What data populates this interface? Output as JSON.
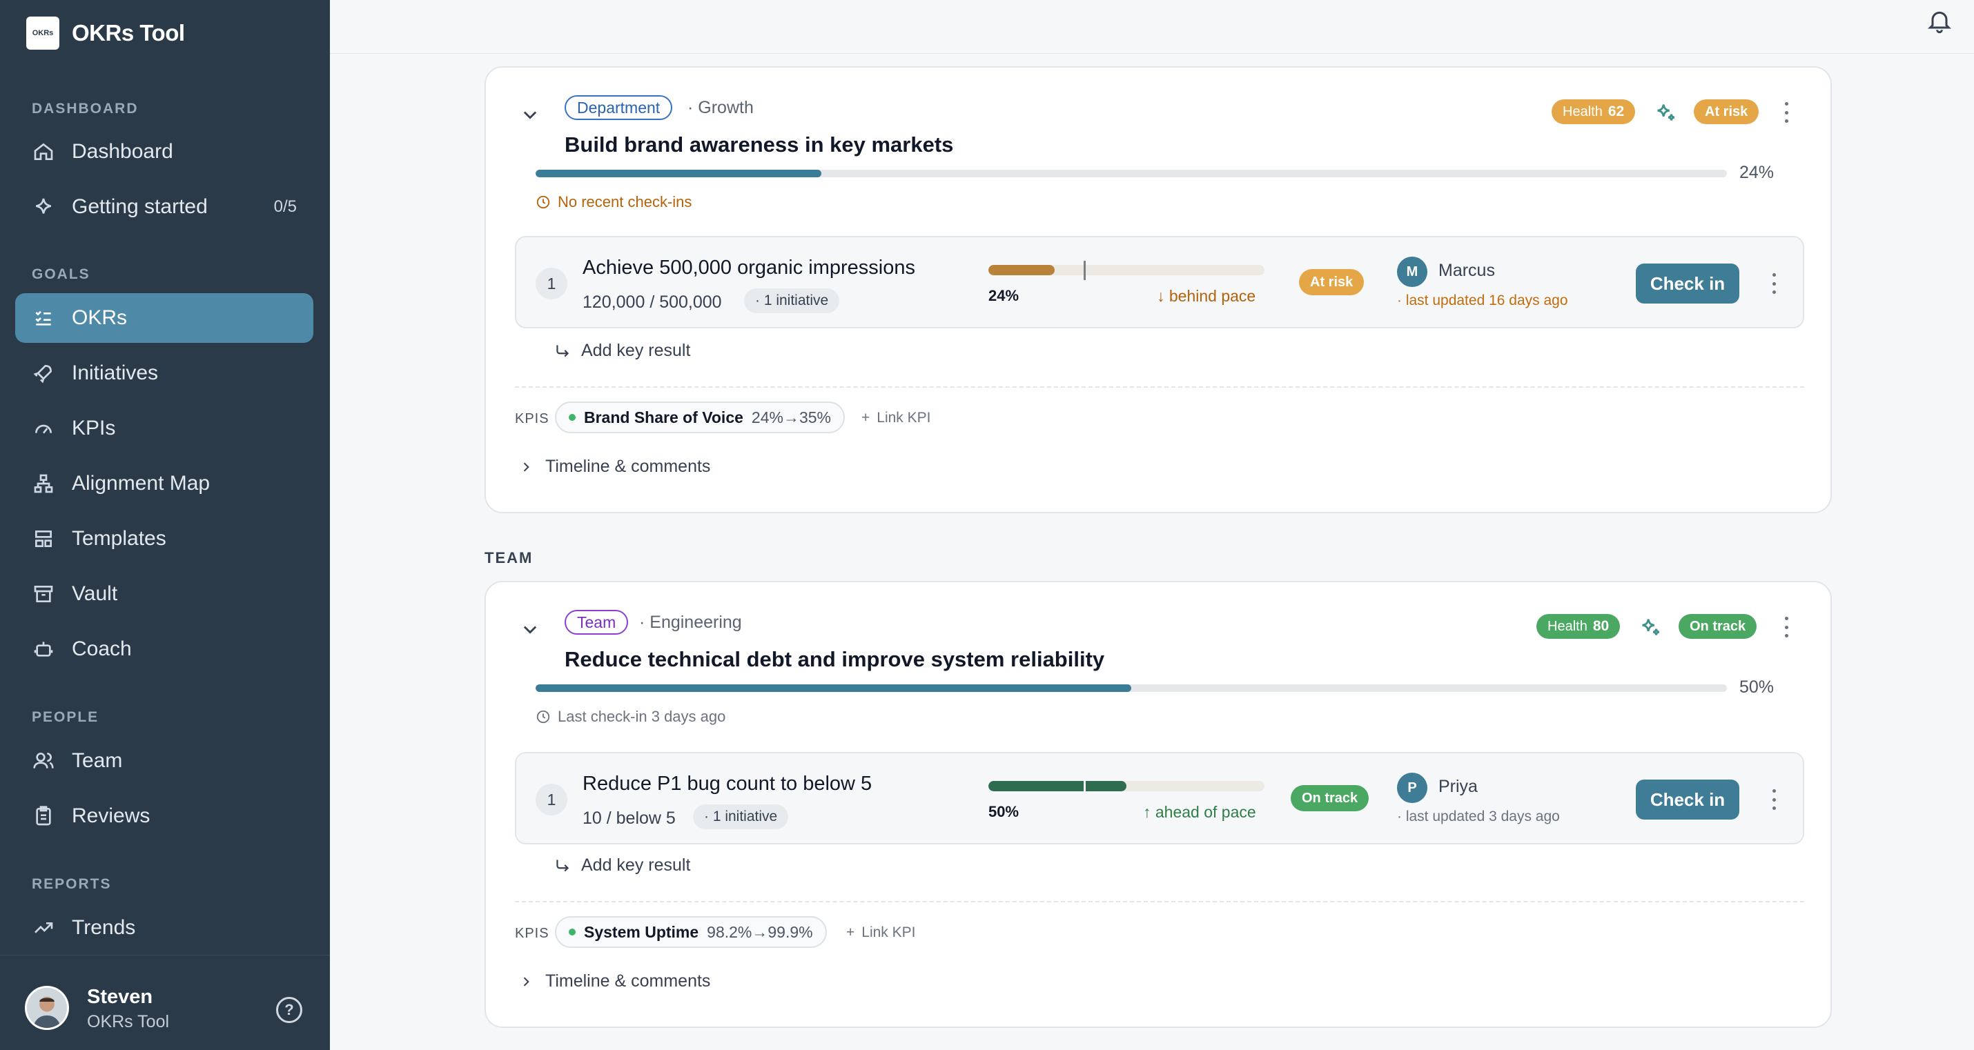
{
  "app": {
    "name": "OKRs Tool",
    "logo_text": "OKRs"
  },
  "sidebar": {
    "sections": {
      "dashboard": "DASHBOARD",
      "goals": "GOALS",
      "people": "PEOPLE",
      "reports": "REPORTS"
    },
    "items": {
      "dashboard": "Dashboard",
      "getting_started": "Getting started",
      "getting_started_count": "0/5",
      "okrs": "OKRs",
      "initiatives": "Initiatives",
      "kpis": "KPIs",
      "alignment_map": "Alignment Map",
      "templates": "Templates",
      "vault": "Vault",
      "coach": "Coach",
      "team": "Team",
      "reviews": "Reviews",
      "trends": "Trends"
    },
    "user": {
      "name": "Steven",
      "org": "OKRs Tool"
    }
  },
  "groups": {
    "team": "TEAM"
  },
  "objectives": [
    {
      "scope": "Department",
      "unit": "· Growth",
      "title": "Build brand awareness in key markets",
      "health_label": "Health",
      "health": "62",
      "status": "At risk",
      "progress": 24,
      "progress_label": "24%",
      "checkin": "No recent check-ins",
      "key_results": [
        {
          "num": "1",
          "title": "Achieve 500,000 organic impressions",
          "value": "120,000 / 500,000",
          "initiatives": "· 1 initiative",
          "progress": 24,
          "progress_label": "24%",
          "pace": "↓ behind pace",
          "status": "At risk",
          "owner_initial": "M",
          "owner": "Marcus",
          "updated": "· last updated 16 days ago",
          "checkin_label": "Check in"
        }
      ],
      "add_kr": "Add key result",
      "kpis_label": "KPIS",
      "kpis": [
        {
          "name": "Brand Share of Voice",
          "range": "24%→35%"
        }
      ],
      "link_kpi": "Link KPI",
      "timeline": "Timeline & comments"
    },
    {
      "scope": "Team",
      "unit": "· Engineering",
      "title": "Reduce technical debt and improve system reliability",
      "health_label": "Health",
      "health": "80",
      "status": "On track",
      "progress": 50,
      "progress_label": "50%",
      "checkin": "Last check-in 3 days ago",
      "key_results": [
        {
          "num": "1",
          "title": "Reduce P1 bug count to below 5",
          "value": "10 / below 5",
          "initiatives": "· 1 initiative",
          "progress": 50,
          "progress_label": "50%",
          "pace": "↑ ahead of pace",
          "status": "On track",
          "owner_initial": "P",
          "owner": "Priya",
          "updated": "· last updated 3 days ago",
          "checkin_label": "Check in"
        }
      ],
      "add_kr": "Add key result",
      "kpis_label": "KPIS",
      "kpis": [
        {
          "name": "System Uptime",
          "range": "98.2%→99.9%"
        }
      ],
      "link_kpi": "Link KPI",
      "timeline": "Timeline & comments"
    }
  ],
  "colors": {
    "sidebar_bg": "#2b3a48",
    "accent": "#3f7c95",
    "at_risk": "#e5a647",
    "on_track": "#4aa863"
  }
}
